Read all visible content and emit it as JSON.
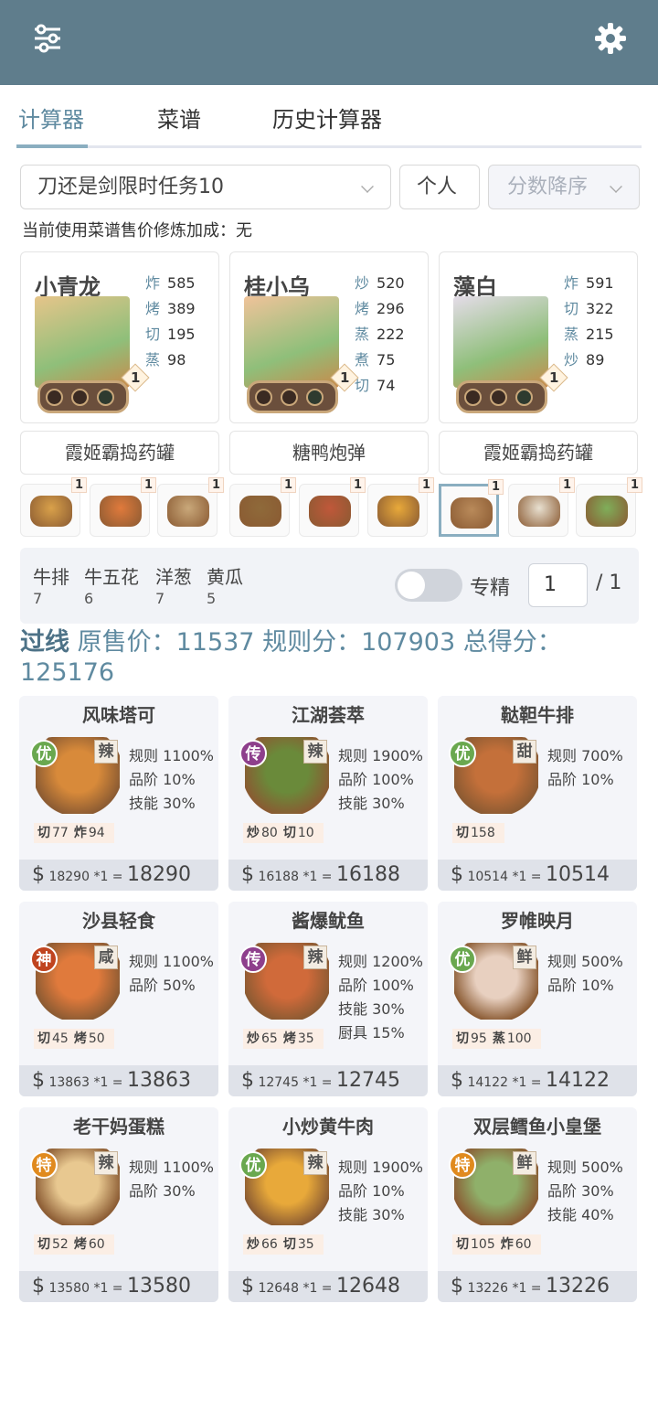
{
  "topbar": {
    "filter_icon": "sliders-icon",
    "settings_icon": "gear-icon",
    "bg": "#5f7d8c"
  },
  "tabs": [
    "计算器",
    "菜谱",
    "历史计算器"
  ],
  "controls": {
    "rule": "刀还是剑限时任务10",
    "mode": "个人",
    "sort": "分数降序"
  },
  "note": "当前使用菜谱售价修炼加成：无",
  "chefs": [
    {
      "name": "小青龙",
      "stats": [
        [
          "炸",
          "585"
        ],
        [
          "烤",
          "389"
        ],
        [
          "切",
          "195"
        ],
        [
          "蒸",
          "98"
        ]
      ],
      "level": "1",
      "color": "#e6c58a"
    },
    {
      "name": "桂小乌",
      "stats": [
        [
          "炒",
          "520"
        ],
        [
          "烤",
          "296"
        ],
        [
          "蒸",
          "222"
        ],
        [
          "煮",
          "75"
        ],
        [
          "切",
          "74"
        ]
      ],
      "level": "1",
      "color": "#f0c39a"
    },
    {
      "name": "藻白",
      "stats": [
        [
          "炸",
          "591"
        ],
        [
          "切",
          "322"
        ],
        [
          "蒸",
          "215"
        ],
        [
          "炒",
          "89"
        ]
      ],
      "level": "1",
      "color": "#e4dce8"
    }
  ],
  "dish_buttons": [
    "霞姬霸捣药罐",
    "糖鸭炮弹",
    "霞姬霸捣药罐"
  ],
  "mini_counts": [
    "1",
    "1",
    "1",
    "1",
    "1",
    "1",
    "1",
    "1",
    "1"
  ],
  "ingredients": [
    [
      "牛排",
      "7"
    ],
    [
      "牛五花",
      "6"
    ],
    [
      "洋葱",
      "7"
    ],
    [
      "黄瓜",
      "5"
    ]
  ],
  "special": {
    "label": "专精",
    "value": "1",
    "total": "/ 1"
  },
  "summary": {
    "pass": "过线",
    "text": "原售价：11537 规则分：107903 总得分：125176"
  },
  "cards": [
    {
      "title": "风味塔可",
      "badge": "优",
      "flavor": "辣",
      "rules": [
        "规则 1100%",
        "品阶 10%",
        "技能 30%"
      ],
      "skills": [
        [
          "切",
          "77"
        ],
        [
          "炸",
          "94"
        ]
      ],
      "price": "18290 *1",
      "total": "18290"
    },
    {
      "title": "江湖荟萃",
      "badge": "传",
      "flavor": "辣",
      "rules": [
        "规则 1900%",
        "品阶 100%",
        "技能 30%"
      ],
      "skills": [
        [
          "炒",
          "80"
        ],
        [
          "切",
          "10"
        ]
      ],
      "price": "16188 *1",
      "total": "16188"
    },
    {
      "title": "鞑靼牛排",
      "badge": "优",
      "flavor": "甜",
      "rules": [
        "规则 700%",
        "品阶 10%"
      ],
      "skills": [
        [
          "切",
          "158"
        ]
      ],
      "price": "10514 *1",
      "total": "10514"
    },
    {
      "title": "沙县轻食",
      "badge": "神",
      "flavor": "咸",
      "rules": [
        "规则 1100%",
        "品阶 50%"
      ],
      "skills": [
        [
          "切",
          "45"
        ],
        [
          "烤",
          "50"
        ]
      ],
      "price": "13863 *1",
      "total": "13863"
    },
    {
      "title": "酱爆鱿鱼",
      "badge": "传",
      "flavor": "辣",
      "rules": [
        "规则 1200%",
        "品阶 100%",
        "技能 30%",
        "厨具 15%"
      ],
      "skills": [
        [
          "炒",
          "65"
        ],
        [
          "烤",
          "35"
        ]
      ],
      "price": "12745 *1",
      "total": "12745"
    },
    {
      "title": "罗帷映月",
      "badge": "优",
      "flavor": "鲜",
      "rules": [
        "规则 500%",
        "品阶 10%"
      ],
      "skills": [
        [
          "切",
          "95"
        ],
        [
          "蒸",
          "100"
        ]
      ],
      "price": "14122 *1",
      "total": "14122"
    },
    {
      "title": "老干妈蛋糕",
      "badge": "特",
      "flavor": "辣",
      "rules": [
        "规则 1100%",
        "品阶 30%"
      ],
      "skills": [
        [
          "切",
          "52"
        ],
        [
          "烤",
          "60"
        ]
      ],
      "price": "13580 *1",
      "total": "13580"
    },
    {
      "title": "小炒黄牛肉",
      "badge": "优",
      "flavor": "辣",
      "rules": [
        "规则 1900%",
        "品阶 10%",
        "技能 30%"
      ],
      "skills": [
        [
          "炒",
          "66"
        ],
        [
          "切",
          "35"
        ]
      ],
      "price": "12648 *1",
      "total": "12648"
    },
    {
      "title": "双层鳕鱼小皇堡",
      "badge": "特",
      "flavor": "鲜",
      "rules": [
        "规则 500%",
        "品阶 30%",
        "技能 40%"
      ],
      "skills": [
        [
          "切",
          "105"
        ],
        [
          "炸",
          "60"
        ]
      ],
      "price": "13226 *1",
      "total": "13226"
    }
  ],
  "badge_colors": {
    "优": "#6aa84f",
    "传": "#8e3f8c",
    "神": "#c0441f",
    "特": "#e08a1e"
  }
}
